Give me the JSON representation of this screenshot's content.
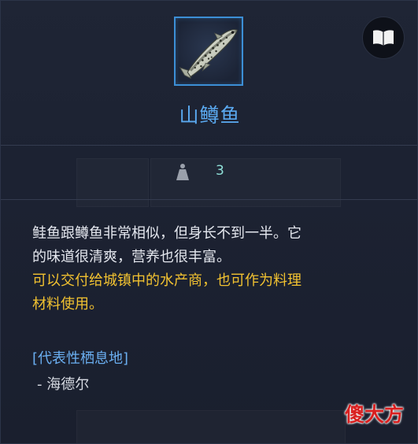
{
  "item": {
    "name": "山鳟鱼",
    "icon": "trout-fish-icon",
    "weight": "3"
  },
  "actions": {
    "encyclopedia_icon": "open-book-icon"
  },
  "description": {
    "line1": "鲑鱼跟鳟鱼非常相似，但身长不到一半。它",
    "line2": "的味道很清爽，营养也很丰富。",
    "highlight_line1": "可以交付给城镇中的水产商，也可作为料理",
    "highlight_line2": "材料使用。"
  },
  "habitat": {
    "title": "[代表性栖息地]",
    "items": [
      "- 海德尔"
    ]
  },
  "watermark": {
    "text": "傻大方"
  },
  "colors": {
    "name": "#5aa9f0",
    "highlight": "#f2c230",
    "weight": "#8fe0d8",
    "frame": "#3c8fd6",
    "watermark": "#d92020"
  }
}
